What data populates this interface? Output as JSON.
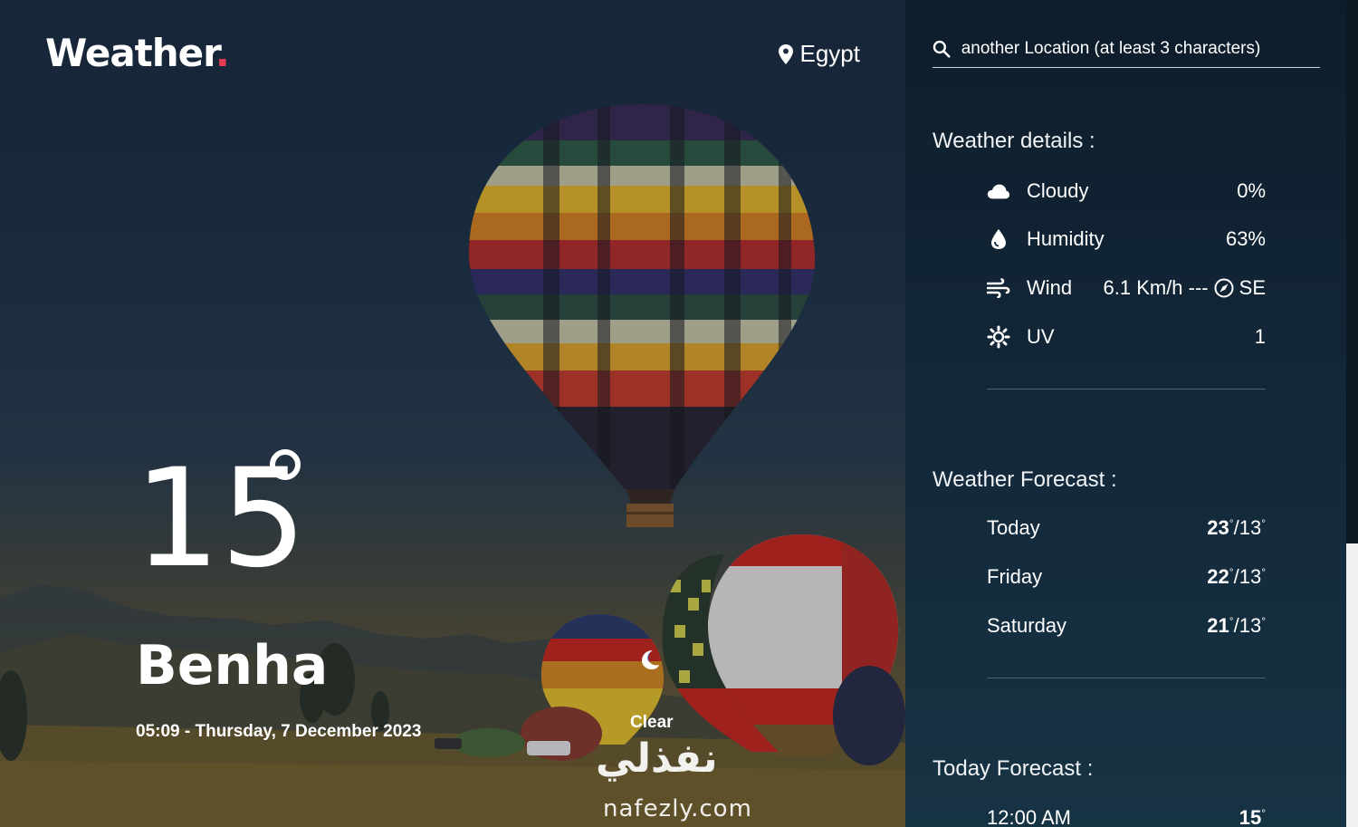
{
  "brand": {
    "name": "Weather",
    "dot": "."
  },
  "location": {
    "country": "Egypt"
  },
  "current": {
    "temp": "15",
    "city": "Benha",
    "datetime": "05:09 - Thursday, 7 December 2023",
    "condition": "Clear"
  },
  "search": {
    "placeholder": "another Location (at least 3 characters)"
  },
  "details": {
    "title": "Weather details :",
    "items": [
      {
        "label": "Cloudy",
        "value": "0%"
      },
      {
        "label": "Humidity",
        "value": "63%"
      },
      {
        "label": "Wind",
        "value": "6.1 Km/h ---",
        "dir": "SE"
      },
      {
        "label": "UV",
        "value": "1"
      }
    ]
  },
  "forecast": {
    "title": "Weather Forecast :",
    "days": [
      {
        "day": "Today",
        "max": "23",
        "min": "13"
      },
      {
        "day": "Friday",
        "max": "22",
        "min": "13"
      },
      {
        "day": "Saturday",
        "max": "21",
        "min": "13"
      }
    ]
  },
  "today": {
    "title": "Today Forecast :",
    "hours": [
      {
        "time": "12:00 AM",
        "temp": "15"
      }
    ]
  },
  "watermark": {
    "arabic": "نفذلي",
    "latin": "nafezly.com"
  },
  "colors": {
    "accent": "#e63b52",
    "panel": "#13283a"
  }
}
